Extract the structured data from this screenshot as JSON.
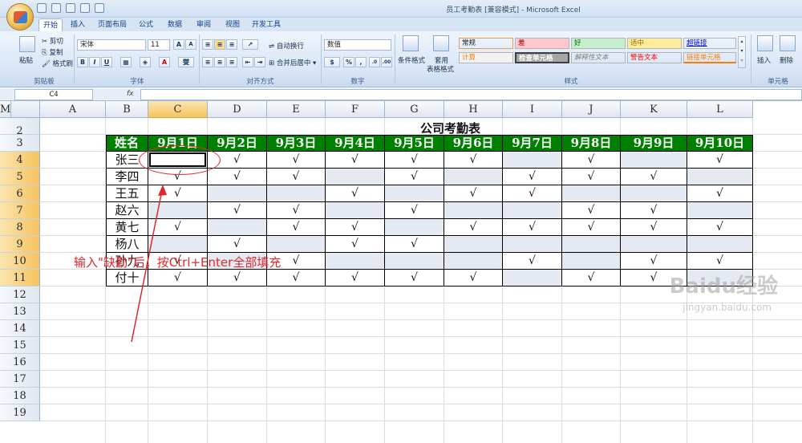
{
  "window": {
    "title": "员工考勤表  [兼容模式] - Microsoft Excel"
  },
  "ribbon": {
    "tabs": [
      "开始",
      "插入",
      "页面布局",
      "公式",
      "数据",
      "审阅",
      "视图",
      "开发工具"
    ],
    "active_tab": "开始",
    "clipboard": {
      "paste": "粘贴",
      "cut": "剪切",
      "copy": "复制",
      "format_painter": "格式刷",
      "label": "剪贴板"
    },
    "font": {
      "name": "宋体",
      "size": "11",
      "label": "字体",
      "bold": "B",
      "italic": "I",
      "underline": "U",
      "grow": "A",
      "shrink": "A",
      "font_color": "A",
      "phonetic": "燮"
    },
    "alignment": {
      "wrap_text": "自动换行",
      "merge_center": "合并后居中",
      "label": "对齐方式"
    },
    "number": {
      "format": "数值",
      "percent": "%",
      "comma": ",",
      "label": "数字"
    },
    "styles": {
      "conditional": "条件格式",
      "table_format": "套用",
      "table_format2": "表格格式",
      "cells": [
        {
          "text": "常规",
          "bg": "#ffffff",
          "color": "#000000"
        },
        {
          "text": "差",
          "bg": "#ffc7ce",
          "color": "#9c0006"
        },
        {
          "text": "好",
          "bg": "#c6efce",
          "color": "#006100"
        },
        {
          "text": "适中",
          "bg": "#ffeb9c",
          "color": "#9c6500"
        },
        {
          "text": "超链接",
          "bg": "#ffffff",
          "color": "#0000ff"
        },
        {
          "text": "计算",
          "bg": "#f2f2f2",
          "color": "#fa7d00"
        },
        {
          "text": "检查单元格",
          "bg": "#a5a5a5",
          "color": "#ffffff"
        },
        {
          "text": "解释性文本",
          "bg": "#ffffff",
          "color": "#7f7f7f"
        },
        {
          "text": "警告文本",
          "bg": "#ffffff",
          "color": "#ff0000"
        },
        {
          "text": "链接单元格",
          "bg": "#ffffff",
          "color": "#fa7d00"
        }
      ],
      "label": "样式"
    },
    "cells_group": {
      "insert": "插入",
      "delete": "删除",
      "label": "单元格"
    }
  },
  "formula_bar": {
    "name_box": "C4",
    "fx": "fx",
    "content": ""
  },
  "columns": [
    "A",
    "B",
    "C",
    "D",
    "E",
    "F",
    "G",
    "H",
    "I",
    "J",
    "K",
    "L",
    "M"
  ],
  "selected_column": "C",
  "rows": [
    "2",
    "3",
    "4",
    "5",
    "6",
    "7",
    "8",
    "9",
    "10",
    "11",
    "12",
    "13",
    "14",
    "15",
    "16",
    "17",
    "18",
    "19"
  ],
  "selected_rows": [
    "4",
    "5",
    "6",
    "7",
    "8",
    "9",
    "10",
    "11"
  ],
  "sheet": {
    "title": "公司考勤表",
    "header": [
      "姓名",
      "9月1日",
      "9月2日",
      "9月3日",
      "9月4日",
      "9月5日",
      "9月6日",
      "9月7日",
      "9月8日",
      "9月9日",
      "9月10日"
    ],
    "employees": [
      {
        "name": "张三",
        "marks": [
          "",
          "√",
          "√",
          "√",
          "√",
          "√",
          "",
          "√",
          "",
          "√"
        ]
      },
      {
        "name": "李四",
        "marks": [
          "√",
          "√",
          "√",
          "",
          "√",
          "",
          "√",
          "√",
          "√",
          ""
        ]
      },
      {
        "name": "王五",
        "marks": [
          "√",
          "",
          "",
          "√",
          "",
          "√",
          "√",
          "",
          "",
          "√"
        ]
      },
      {
        "name": "赵六",
        "marks": [
          "",
          "√",
          "√",
          "",
          "√",
          "",
          "",
          "√",
          "√",
          ""
        ]
      },
      {
        "name": "黄七",
        "marks": [
          "√",
          "",
          "√",
          "√",
          "",
          "√",
          "√",
          "√",
          "√",
          "√"
        ]
      },
      {
        "name": "杨八",
        "marks": [
          "",
          "√",
          "",
          "√",
          "√",
          "",
          "",
          "",
          "",
          ""
        ]
      },
      {
        "name": "孙九",
        "marks": [
          "√",
          "",
          "√",
          "",
          "",
          "",
          "√",
          "",
          "√",
          "√"
        ]
      },
      {
        "name": "付十",
        "marks": [
          "√",
          "√",
          "√",
          "√",
          "√",
          "√",
          "",
          "√",
          "√",
          ""
        ]
      }
    ]
  },
  "annotation": {
    "text": "输入\"缺勤\"后，按Ctrl+Enter全部填充",
    "color": "#e1272c"
  },
  "watermark": {
    "logo": "Baidu经验",
    "url": "jingyan.baidu.com"
  }
}
